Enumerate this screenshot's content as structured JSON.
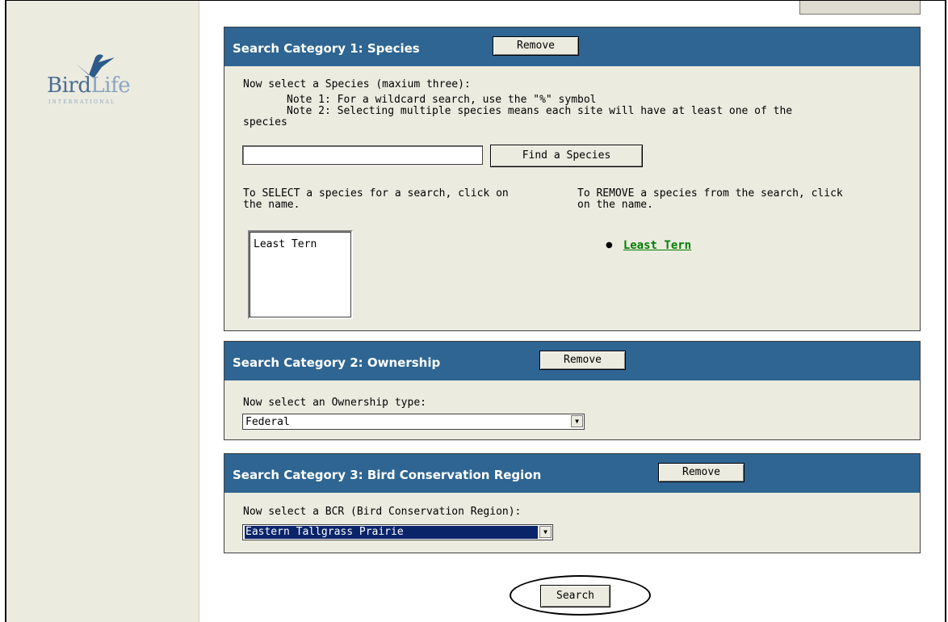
{
  "logo": {
    "name_part1": "Bird",
    "name_part2": "Life",
    "subtitle": "INTERNATIONAL"
  },
  "categories": [
    {
      "title": "Search Category 1:  Species",
      "remove_label": "Remove",
      "prompt": "Now select a Species (maxium three):",
      "note1": "Note 1: For a wildcard search, use the \"%\" symbol",
      "note2": "Note 2: Selecting multiple species means each site will have at least one of the",
      "note2_cont": "species",
      "search_value": "",
      "find_label": "Find a Species",
      "select_instr_1": "To SELECT a species for a search, click on",
      "select_instr_2": "the name.",
      "remove_instr_1": "To REMOVE a species from the search, click",
      "remove_instr_2": "on the name.",
      "list_items": [
        "Least Tern"
      ],
      "selected_items": [
        "Least Tern"
      ]
    },
    {
      "title": "Search Category 2:  Ownership",
      "remove_label": "Remove",
      "prompt": "Now select an Ownership type:",
      "selected": "Federal"
    },
    {
      "title": "Search Category 3:  Bird Conservation Region",
      "remove_label": "Remove",
      "prompt": "Now select a BCR (Bird Conservation Region):",
      "selected": "Eastern Tallgrass Prairie"
    }
  ],
  "search_label": "Search",
  "colors": {
    "header": "#2e6592",
    "panel_bg": "#ecebe0",
    "link": "#008000",
    "selected": "#0a246a"
  }
}
